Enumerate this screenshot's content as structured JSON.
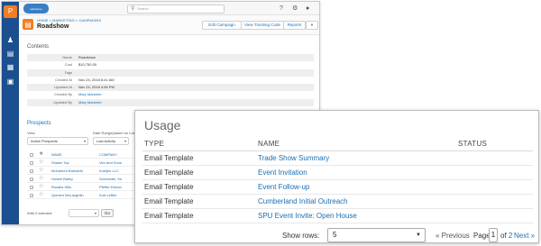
{
  "app": {
    "logo_text": "salesforce",
    "search_placeholder": "Search",
    "help_icon": "?",
    "settings_icon": "⚙",
    "user_icon": "●"
  },
  "rail": {
    "icons": [
      "pardot-logo-icon",
      "prospects-icon",
      "marketing-icon",
      "reports-icon",
      "admin-icon"
    ]
  },
  "header": {
    "breadcrumb": "HOME » MARKETING » CAMPAIGNS",
    "title": "Roadshow",
    "buttons": [
      "Edit Campaign",
      "View Tracking Code",
      "Reports",
      "▾"
    ]
  },
  "contents": {
    "title": "Contents",
    "fields": [
      {
        "label": "Name",
        "value": "Roadshow",
        "link": false
      },
      {
        "label": "Cost",
        "value": "$10,750.00",
        "link": false
      },
      {
        "label": "Tags",
        "value": "",
        "link": false
      },
      {
        "label": "Created At",
        "value": "Nov 24, 2018 6:41 AM",
        "link": false
      },
      {
        "label": "Updated At",
        "value": "Nov 24, 2018 4:56 PM",
        "link": false
      },
      {
        "label": "Created By",
        "value": "Mary Marketer",
        "link": true
      },
      {
        "label": "Updated By",
        "value": "Mary Marketer",
        "link": true
      }
    ]
  },
  "prospects": {
    "title": "Prospects",
    "view_label": "View",
    "view_value": "Active Prospects",
    "range_label": "Date Range(based on Last",
    "range_value": "Last Activity",
    "columns": {
      "name": "NAME",
      "company": "COMPANY"
    },
    "rows": [
      {
        "name": "Shawn Top",
        "company": "Ven and Sons"
      },
      {
        "name": "Mohamed Bartoletti",
        "company": "Koelpin LLC"
      },
      {
        "name": "Howell Bailey",
        "company": "Schroeder, Ke"
      },
      {
        "name": "Rosalia Hills",
        "company": "Pfeffer-Rohan"
      },
      {
        "name": "Quinten McLaughlin",
        "company": "Kub-Leffler"
      }
    ],
    "with_checked": "With 0 selected:",
    "go_label": "Go"
  },
  "usage": {
    "title": "Usage",
    "columns": {
      "type": "TYPE",
      "name": "NAME",
      "status": "STATUS"
    },
    "rows": [
      {
        "type": "Email Template",
        "name": "Trade Show Summary",
        "status": ""
      },
      {
        "type": "Email Template",
        "name": "Event Invitation",
        "status": ""
      },
      {
        "type": "Email Template",
        "name": "Event Follow-up",
        "status": ""
      },
      {
        "type": "Email Template",
        "name": "Cumberland Initial Outreach",
        "status": ""
      },
      {
        "type": "Email Template",
        "name": "SPU Event Invite: Open House",
        "status": ""
      }
    ],
    "pager": {
      "rows_label": "Show rows:",
      "rows_value": "5",
      "previous": "« Previous",
      "page_label": "Page",
      "page_value": "1",
      "of_label": "of",
      "total_pages": "2",
      "next": "Next »"
    }
  },
  "colors": {
    "rail": "#1b4f8f",
    "accent_orange": "#f07e22",
    "link_blue": "#1a6fb5"
  }
}
